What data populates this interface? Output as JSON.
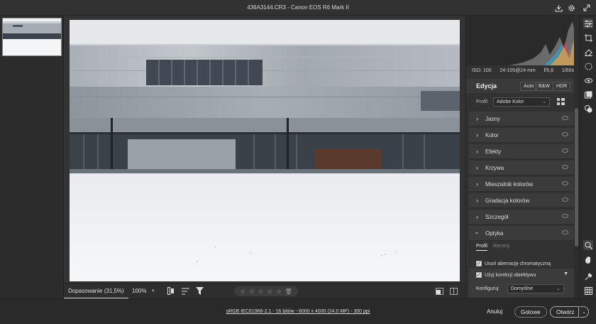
{
  "window": {
    "title": "436A3144.CR3  -  Canon EOS R6 Mark II"
  },
  "camera_info": {
    "iso": "ISO: 100",
    "lens": "24-105@24 mm",
    "aperture": "f/5,6",
    "shutter": "1/60s"
  },
  "edit_panel": {
    "title": "Edycja",
    "buttons": [
      "Auto",
      "B&W",
      "HDR"
    ],
    "profile_label": "Profil",
    "profile_value": "Adobe Kolor",
    "sections": [
      "Jasny",
      "Kolor",
      "Efekty",
      "Krzywa",
      "Mieszalnik kolorów",
      "Gradacja kolorów",
      "Szczegół",
      "Optyka"
    ],
    "optyka": {
      "tabs": [
        "Profil",
        "Ręczny"
      ],
      "chrom_label": "Usuń aberrację chromatyczną",
      "lens_label": "Użyj korekcji obiektywu",
      "configure_label": "Konfiguruj",
      "configure_value": "Domyślne"
    }
  },
  "bottom_bar": {
    "fit_label": "Dopasowanie (31,5%)",
    "zoom_label": "100%"
  },
  "footer": {
    "info": "sRGB IEC61966-2.1 - 16 bitów - 6000 x 4000 (24.0 MP) - 300 ppi",
    "cancel": "Anuluj",
    "done": "Gotowe",
    "open": "Otwórz"
  },
  "icons": [
    "export-icon",
    "gear-icon",
    "expand-icon",
    "edit-sliders-icon",
    "crop-icon",
    "eraser-icon",
    "mask-icon",
    "redeye-icon",
    "presets-icon",
    "snapshots-icon",
    "zoom-icon",
    "hand-icon",
    "color-sampler-icon",
    "grid-icon"
  ]
}
